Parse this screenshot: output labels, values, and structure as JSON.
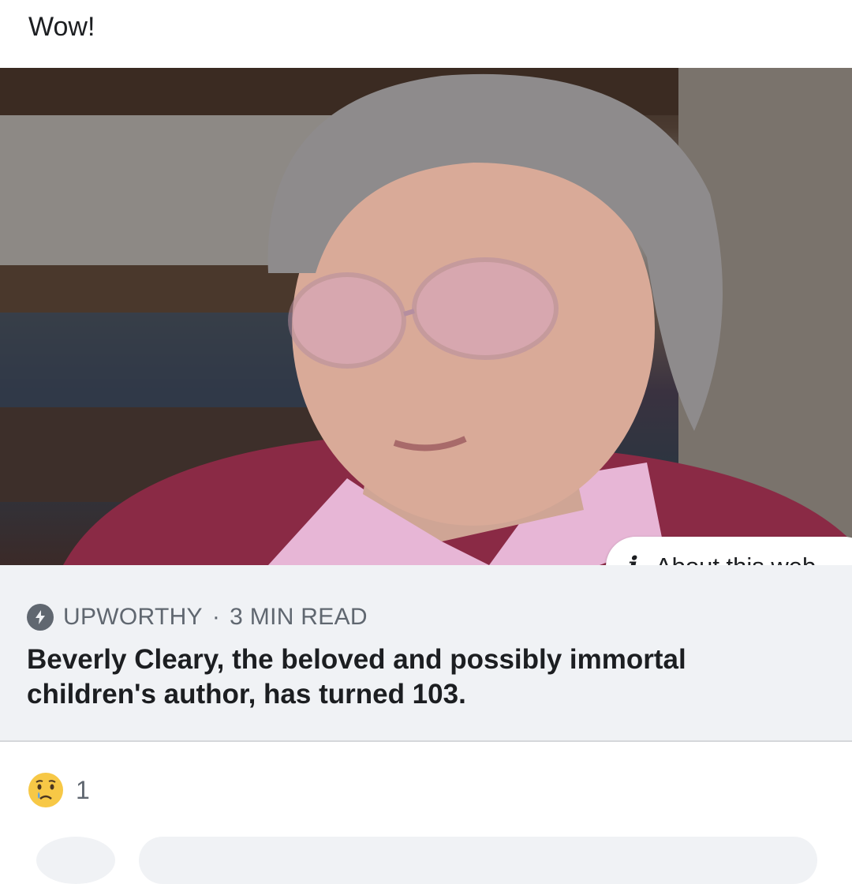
{
  "post": {
    "text": "Wow!"
  },
  "link_preview": {
    "image_alt": "Elderly woman with gray hair and pink glasses wearing a pink collared shirt and red patterned cardigan",
    "about_label": "About this web",
    "source": "UPWORTHY",
    "separator": "·",
    "read_time": "3 MIN READ",
    "headline": "Beverly Cleary, the beloved and possibly immortal children's author, has turned 103."
  },
  "reactions": {
    "icon": "sad-face-icon",
    "count": "1"
  }
}
